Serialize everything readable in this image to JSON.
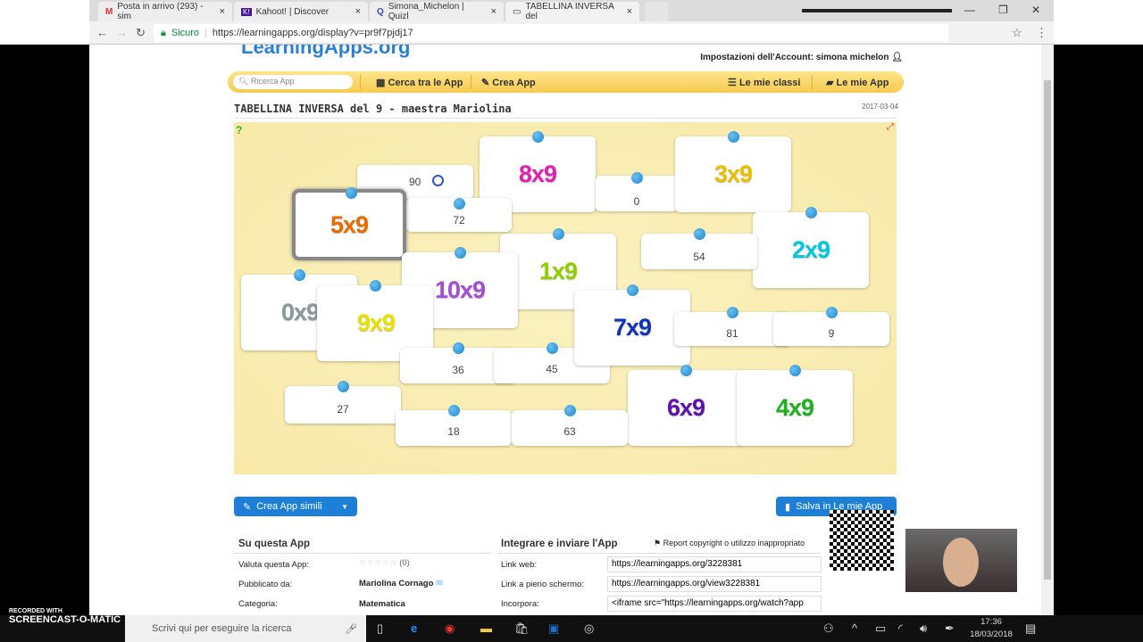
{
  "browser": {
    "tabs": [
      {
        "label": "Posta in arrivo (293) - sim"
      },
      {
        "label": "Kahoot! | Discover"
      },
      {
        "label": "Simona_Michelon | Quizl"
      },
      {
        "label": "TABELLINA INVERSA del"
      }
    ],
    "secure_label": "Sicuro",
    "url": "https://learningapps.org/display?v=pr9f7pjdj17"
  },
  "site": {
    "logo": "LearningApps.org",
    "account": "Impostazioni dell'Account: simona michelon",
    "search_placeholder": "Ricerca App",
    "nav": {
      "browse": "Cerca tra le App",
      "create": "Crea App",
      "classes": "Le mie classi",
      "myapps": "Le mie App"
    },
    "title": "TABELLINA INVERSA del 9 - maestra Mariolina",
    "date": "2017-03-04"
  },
  "game": {
    "cards": [
      "90",
      "8x9",
      "0",
      "3x9",
      "5x9",
      "72",
      "2x9",
      "54",
      "1x9",
      "10x9",
      "0x9",
      "9x9",
      "7x9",
      "81",
      "9",
      "36",
      "45",
      "6x9",
      "4x9",
      "27",
      "18",
      "63"
    ]
  },
  "actions": {
    "similar": "Crea App simili",
    "save": "Salva in Le mie App"
  },
  "about": {
    "heading": "Su questa App",
    "rate_label": "Valuta questa App:",
    "rating_count": "(0)",
    "rating": 0,
    "published_label": "Pubblicato da:",
    "author": "Mariolina Cornago",
    "category_label": "Categoria:",
    "category": "Matematica"
  },
  "share": {
    "heading": "Integrare e inviare l'App",
    "report": "Report copyright o utilizzo inappropriato",
    "web_label": "Link web:",
    "web": "https://learningapps.org/3228381",
    "full_label": "Link a pieno schermo:",
    "full": "https://learningapps.org/view3228381",
    "embed_label": "Incorpora:",
    "embed": "<iframe src=\"https://learningapps.org/watch?app"
  },
  "taskbar": {
    "watermark_top": "RECORDED WITH",
    "watermark": "SCREENCAST-O-MATIC",
    "search": "Scrivi qui per eseguire la ricerca",
    "time": "17:36",
    "date": "18/03/2018"
  }
}
